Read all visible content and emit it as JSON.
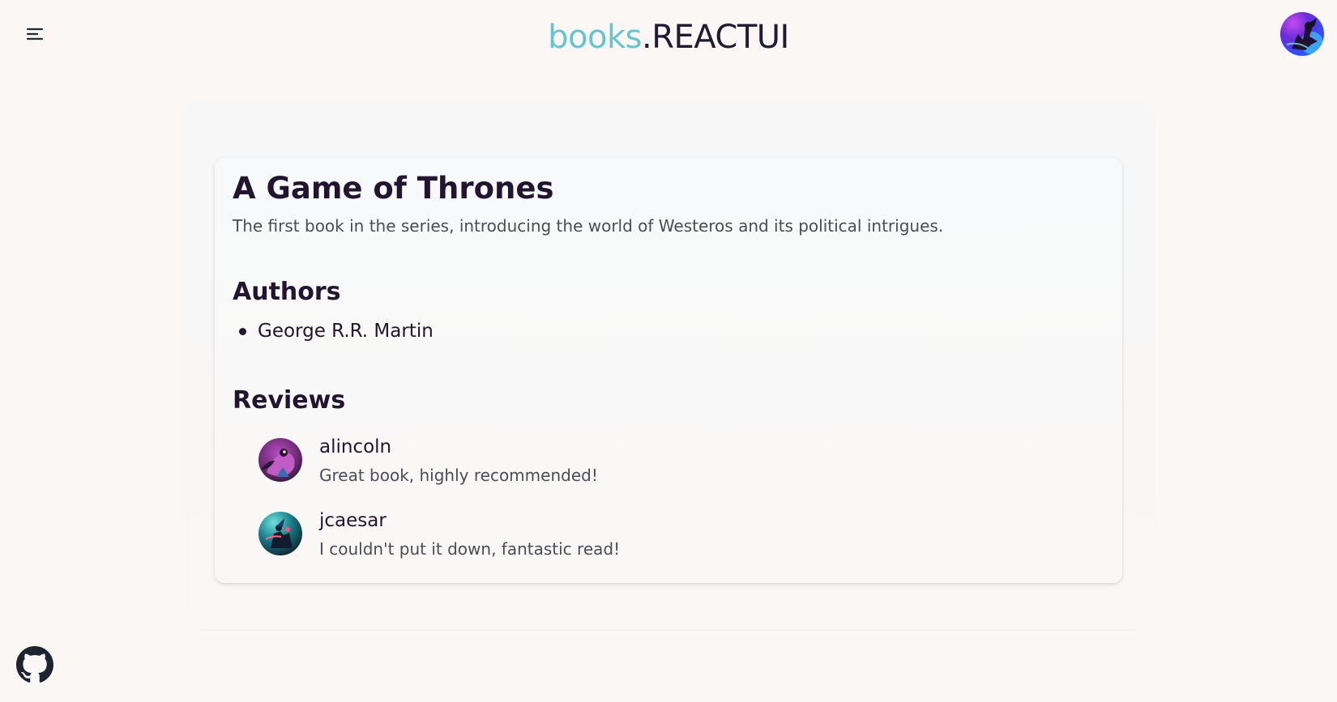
{
  "header": {
    "brand_accent": "books",
    "brand_dot": ".",
    "brand_main": "REACTUI",
    "menu_icon": "menu-icon"
  },
  "book": {
    "title": "A Game of Thrones",
    "description": "The first book in the series, introducing the world of Westeros and its political intrigues.",
    "authors_heading": "Authors",
    "authors": [
      "George R.R. Martin"
    ],
    "reviews_heading": "Reviews",
    "reviews": [
      {
        "user": "alincoln",
        "text": "Great book, highly recommended!"
      },
      {
        "user": "jcaesar",
        "text": "I couldn't put it down, fantastic read!"
      }
    ]
  },
  "footer": {
    "github_icon": "github-icon"
  },
  "colors": {
    "background": "#faf7f5",
    "brand_accent": "#66c6cf",
    "text_dark": "#22152f",
    "text_muted": "#4b4d55"
  }
}
